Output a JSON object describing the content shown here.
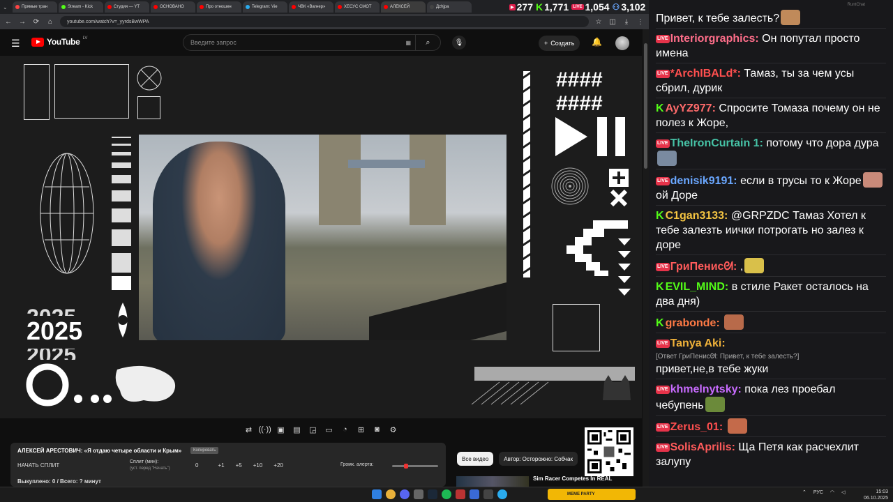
{
  "browser": {
    "tabs": [
      {
        "label": "Прямые тран",
        "color": "#ff4444"
      },
      {
        "label": "Stream - Kick",
        "color": "#53fc18"
      },
      {
        "label": "Студия — YT",
        "color": "#ff0000"
      },
      {
        "label": "ОСНОВАНО",
        "color": "#ff0000"
      },
      {
        "label": "Про отношен",
        "color": "#ff0000"
      },
      {
        "label": "Telegram: Vie",
        "color": "#2aabee"
      },
      {
        "label": "ЧВК «Вагнер»",
        "color": "#ff0000"
      },
      {
        "label": "ХЕСУС СМОТ",
        "color": "#ff0000"
      },
      {
        "label": "АЛЕКСЕЙ",
        "color": "#ff0000"
      },
      {
        "label": "Дzhjра",
        "color": "#444444"
      }
    ],
    "url": "youtube.com/watch?v=_yyrdsBwWPA"
  },
  "stats": {
    "youtube": "277",
    "kick": "1,771",
    "vk": "1,054",
    "total": "3,102"
  },
  "youtube": {
    "logo": "YouTube",
    "country": "LV",
    "search_placeholder": "Введите запрос",
    "create_label": "Создать"
  },
  "overlay": {
    "year": "2025",
    "hash_row": "####"
  },
  "panel": {
    "title": "АЛЕКСЕЙ АРЕСТОВИЧ: «Я отдаю четыре области и Крым»",
    "copy_label": "Копировать",
    "split_button": "НАЧАТЬ СПЛИТ",
    "split_label": "Сплит (мин):",
    "split_hint": "(уст. перед \"Начать\")",
    "split_value": "0",
    "increments": [
      "+1",
      "+5",
      "+10",
      "+20"
    ],
    "volume_label": "Громк. алерта:",
    "volume_level": 0.25,
    "bought": "Выкуплено: 0 / Всего: ? минут"
  },
  "chips": [
    "Все видео",
    "Автор: Осторожно: Собчак"
  ],
  "recommended": {
    "title": "Sim Racer Competes In REAL"
  },
  "chat": {
    "header": "RuntChat",
    "messages": [
      {
        "platform": "none",
        "nick": "",
        "color": "#ffffff",
        "text": "Привет, к тебе залесть?",
        "emote": "#c08a5a"
      },
      {
        "platform": "live",
        "nick": "Interiorgraphics:",
        "color": "#ff6e8a",
        "text": "Он попутал просто имена"
      },
      {
        "platform": "live",
        "nick": "*ArchIBALd*:",
        "color": "#ff4f4f",
        "text": "Тамаз, ты за чем усы сбрил, дурик"
      },
      {
        "platform": "kick",
        "nick": "AyYZ977:",
        "color": "#ff6b6b",
        "text": "Спросите Томаза почему он не полез к Жоре,"
      },
      {
        "platform": "live",
        "nick": "TheIronCurtain 1:",
        "color": "#46c2a6",
        "text": "потому что дора дура",
        "emote": "#7a8aa0"
      },
      {
        "platform": "live",
        "nick": "denisik9191:",
        "color": "#6aa7ff",
        "text": "если в трусы то к Жоре",
        "emote": "#c98a7a",
        "after": "ой Доре"
      },
      {
        "platform": "kick",
        "nick": "C1gan3133:",
        "color": "#f5c542",
        "text": "@GRPZDC Тамаз Хотел к тебе залезть иички потрогать но залез к доре"
      },
      {
        "platform": "live",
        "nick": "ГриПенисᘛ:",
        "color": "#ff5b5b",
        "text": ",",
        "emote": "#d9c04a"
      },
      {
        "platform": "kick",
        "nick": "EVIL_MIND:",
        "color": "#53fc18",
        "text": "в стиле Ракет осталось на два дня)"
      },
      {
        "platform": "kick",
        "nick": "grabonde:",
        "color": "#ff7a45",
        "text": "",
        "emote": "#b86a4a"
      },
      {
        "platform": "live",
        "nick": "Tanya Aki:",
        "color": "#f0b23a",
        "text": "",
        "reply": "[Ответ ГриПенисᘛ: Привет, к тебе залесть?]",
        "after": "привет,не,в тебе жуки"
      },
      {
        "platform": "live",
        "nick": "khmelnytsky:",
        "color": "#c86bff",
        "text": "пока лез проебал чебупень",
        "emote": "#6b8a3a"
      },
      {
        "platform": "live",
        "nick": "Zerus_01:",
        "color": "#ff4f4f",
        "text": "",
        "emote": "#c46a4a"
      },
      {
        "platform": "live",
        "nick": "SolisAprilis:",
        "color": "#ff5b5b",
        "text": "Ща Петя как расчехлит залупу"
      }
    ]
  },
  "taskbar": {
    "meme_label": "MEME PARTY",
    "lang": "РУС",
    "time": "15:03",
    "date": "06.10.2025"
  }
}
